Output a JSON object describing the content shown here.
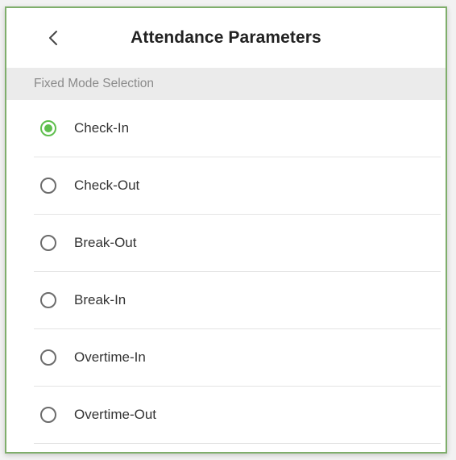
{
  "header": {
    "title": "Attendance Parameters",
    "back_icon": "chevron-left-icon"
  },
  "section": {
    "label": "Fixed Mode Selection"
  },
  "options": [
    {
      "label": "Check-In",
      "selected": true
    },
    {
      "label": "Check-Out",
      "selected": false
    },
    {
      "label": "Break-Out",
      "selected": false
    },
    {
      "label": "Break-In",
      "selected": false
    },
    {
      "label": "Overtime-In",
      "selected": false
    },
    {
      "label": "Overtime-Out",
      "selected": false
    }
  ],
  "colors": {
    "accent": "#5fbf4e",
    "frame_border": "#7fae6b",
    "section_bg": "#ebebeb",
    "radio_unselected": "#6c6c6c"
  }
}
